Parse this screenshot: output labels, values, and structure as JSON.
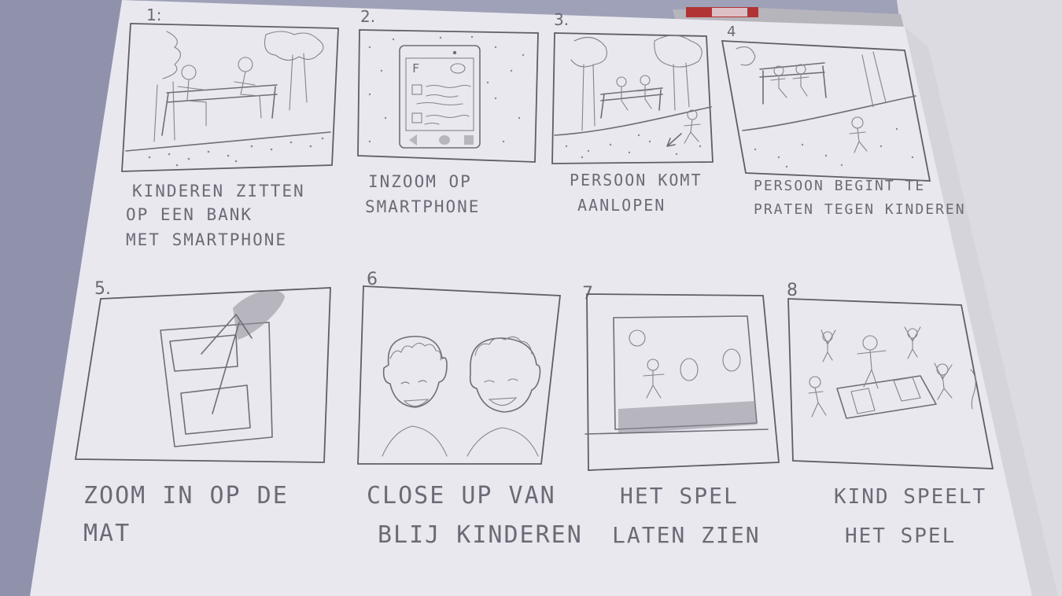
{
  "panels": [
    {
      "number": "1:",
      "caption": [
        "KINDEREN ZITTEN",
        "OP EEN BANK",
        "MET SMARTPHONE"
      ]
    },
    {
      "number": "2.",
      "caption": [
        "INZOOM OP",
        "SMARTPHONE"
      ]
    },
    {
      "number": "3.",
      "caption": [
        "PERSOON KOMT",
        "AANLOPEN"
      ]
    },
    {
      "number": "4",
      "caption": [
        "PERSOON BEGINT TE",
        "PRATEN TEGEN KINDEREN"
      ]
    },
    {
      "number": "5.",
      "caption": [
        "ZOOM IN OP DE",
        "MAT"
      ]
    },
    {
      "number": "6",
      "caption": [
        "CLOSE UP VAN",
        "BLIJ KINDEREN"
      ]
    },
    {
      "number": "7",
      "caption": [
        "HET SPEL",
        "LATEN ZIEN"
      ]
    },
    {
      "number": "8",
      "caption": [
        "KIND SPEELT",
        "HET SPEL"
      ]
    }
  ],
  "phone_screen_letter": "F",
  "colors": {
    "paper": "#e9e8ee",
    "pencil": "#6f6d78",
    "background": "#9ea1b8",
    "book_spine": "#b03030"
  }
}
